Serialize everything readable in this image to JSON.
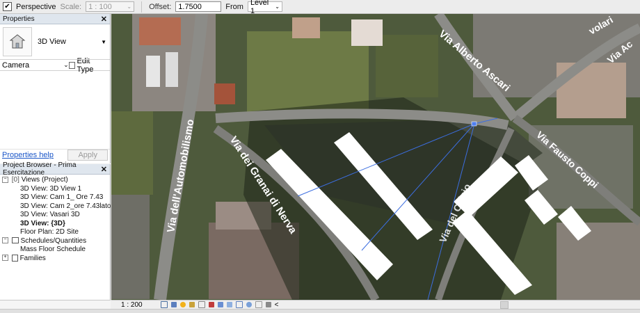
{
  "options_bar": {
    "perspective_checked": "✔",
    "perspective_label": "Perspective",
    "scale_label": "Scale:",
    "scale_value": "1 : 100",
    "offset_label": "Offset:",
    "offset_value": "1.7500",
    "from_label": "From",
    "from_value": "Level 1"
  },
  "properties": {
    "title": "Properties",
    "close": "✕",
    "type_name": "3D View",
    "category": "Camera",
    "edit_type": "Edit Type",
    "help_link": "Properties help",
    "apply": "Apply"
  },
  "browser": {
    "title": "Project Browser - Prima Esercitazione",
    "close": "✕",
    "views_header": "Views (Project)",
    "views": [
      "3D View: 3D View 1",
      "3D View: Cam 1_ Ore 7.43",
      "3D View: Cam 2_ore 7.43lato",
      "3D View: Vasari 3D",
      "3D View: {3D}",
      "Floor Plan: 2D Site"
    ],
    "schedules_header": "Schedules/Quantities",
    "schedules": [
      "Mass Floor Schedule"
    ],
    "families_header": "Families"
  },
  "status_bar": {
    "scale": "1 : 200",
    "scroll_left": "<"
  },
  "streets": [
    "Via dell'Automobilismo",
    "Via dei Granai di Nerva",
    "Via Alberto Ascari",
    "Via Fausto Coppi",
    "Via del Calcio",
    "volari",
    "Via Ac"
  ],
  "colors": {
    "panel_header": "#dfe6ee",
    "link": "#1a56c8",
    "camera_line": "#3c6ee0",
    "mass_white": "#ffffff"
  }
}
